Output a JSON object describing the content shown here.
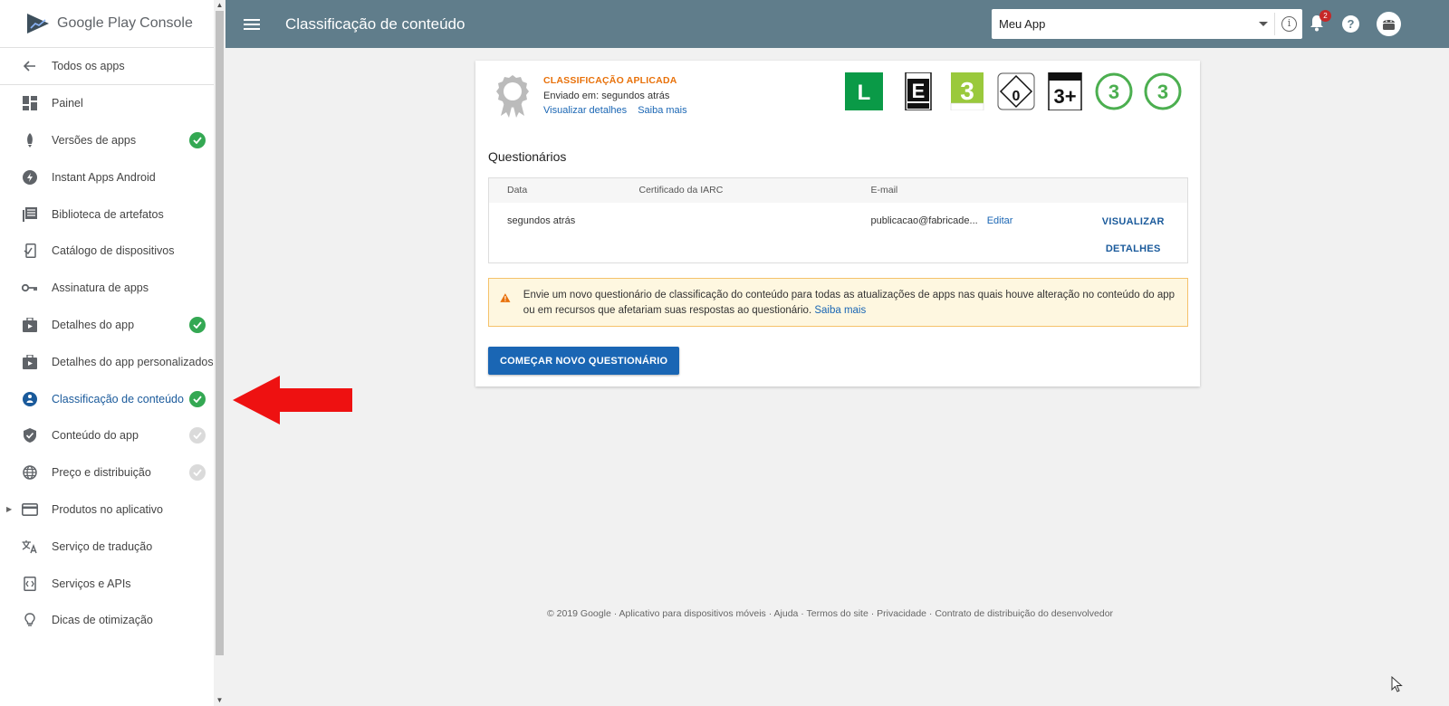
{
  "sidebar": {
    "brand_google_play": "Google Play",
    "brand_console": "Console",
    "back_label": "Todos os apps",
    "items": [
      {
        "label": "Painel",
        "icon": "dashboard-icon",
        "status": "none"
      },
      {
        "label": "Versões de apps",
        "icon": "rocket-icon",
        "status": "complete"
      },
      {
        "label": "Instant Apps Android",
        "icon": "bolt-icon",
        "status": "none"
      },
      {
        "label": "Biblioteca de artefatos",
        "icon": "library-icon",
        "status": "none"
      },
      {
        "label": "Catálogo de dispositivos",
        "icon": "device-catalog-icon",
        "status": "none"
      },
      {
        "label": "Assinatura de apps",
        "icon": "key-icon",
        "status": "none"
      },
      {
        "label": "Detalhes do app",
        "icon": "store-icon",
        "status": "complete"
      },
      {
        "label": "Detalhes do app personalizados",
        "icon": "store-icon",
        "status": "none"
      },
      {
        "label": "Classificação de conteúdo",
        "icon": "rating-icon",
        "status": "complete",
        "active": true
      },
      {
        "label": "Conteúdo do app",
        "icon": "shield-icon",
        "status": "pending"
      },
      {
        "label": "Preço e distribuição",
        "icon": "globe-icon",
        "status": "pending"
      },
      {
        "label": "Produtos no aplicativo",
        "icon": "card-icon",
        "status": "none",
        "expandable": true
      },
      {
        "label": "Serviço de tradução",
        "icon": "translate-icon",
        "status": "none"
      },
      {
        "label": "Serviços e APIs",
        "icon": "api-icon",
        "status": "none"
      },
      {
        "label": "Dicas de otimização",
        "icon": "lightbulb-icon",
        "status": "none"
      }
    ]
  },
  "topbar": {
    "title": "Classificação de conteúdo",
    "app_selector_value": "Meu App",
    "notification_count": "2",
    "help_label": "?"
  },
  "rating_summary": {
    "status_label": "CLASSIFICAÇÃO APLICADA",
    "sent_text": "Enviado em: segundos atrás",
    "view_details_link": "Visualizar detalhes",
    "learn_more_link": "Saiba mais",
    "badges": [
      {
        "name": "rating-l-badge",
        "text": "L"
      },
      {
        "name": "esrb-e-badge",
        "text": "E"
      },
      {
        "name": "pegi-3-badge",
        "text": "3"
      },
      {
        "name": "usk-0-badge",
        "text": "0"
      },
      {
        "name": "iarc-3-badge",
        "text": "3+"
      },
      {
        "name": "generic-3-badge",
        "text": "3"
      },
      {
        "name": "generic-3-badge-2",
        "text": "3"
      }
    ]
  },
  "questionnaires": {
    "title": "Questionários",
    "columns": [
      "Data",
      "Certificado da IARC",
      "E-mail"
    ],
    "rows": [
      {
        "date": "segundos atrás",
        "certificate": "",
        "email": "publicacao@fabricade...",
        "edit_label": "Editar",
        "view_label_1": "VISUALIZAR",
        "view_label_2": "DETALHES"
      }
    ]
  },
  "warning": {
    "text": "Envie um novo questionário de classificação do conteúdo para todas as atualizações de apps nas quais houve alteração no conteúdo do app ou em recursos que afetariam suas respostas ao questionário.",
    "link": "Saiba mais"
  },
  "start_button_label": "COMEÇAR NOVO QUESTIONÁRIO",
  "footer": "© 2019 Google · Aplicativo para dispositivos móveis · Ajuda · Termos do site · Privacidade · Contrato de distribuição do desenvolvedor",
  "colors": {
    "topbar": "#607d8b",
    "accent_blue": "#1a66b4",
    "status_orange": "#e8710a",
    "check_green": "#34a853",
    "warning_bg": "#fef7e0"
  }
}
